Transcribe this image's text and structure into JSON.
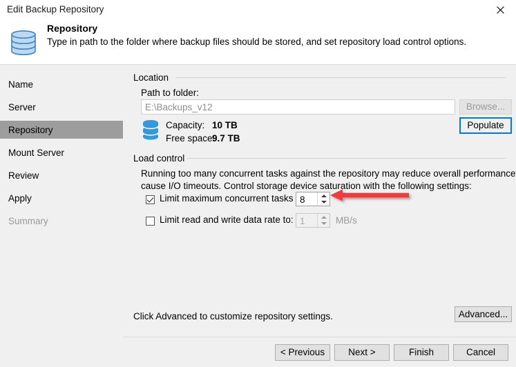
{
  "window": {
    "title": "Edit Backup Repository",
    "close_icon": "close-icon"
  },
  "header": {
    "icon": "repository-database-icon",
    "title": "Repository",
    "subtitle": "Type in path to the folder where backup files should be stored, and set repository load control options."
  },
  "sidebar": {
    "items": [
      {
        "label": "Name",
        "state": "normal"
      },
      {
        "label": "Server",
        "state": "normal"
      },
      {
        "label": "Repository",
        "state": "selected"
      },
      {
        "label": "Mount Server",
        "state": "normal"
      },
      {
        "label": "Review",
        "state": "normal"
      },
      {
        "label": "Apply",
        "state": "normal"
      },
      {
        "label": "Summary",
        "state": "disabled"
      }
    ]
  },
  "location": {
    "group_label": "Location",
    "path_label": "Path to folder:",
    "path_value": "E:\\Backups_v12",
    "browse_label": "Browse...",
    "populate_label": "Populate",
    "storage_icon": "database-icon",
    "capacity_label": "Capacity:",
    "capacity_value": "10 TB",
    "free_space_label": "Free space:",
    "free_space_value": "9.7 TB"
  },
  "load_control": {
    "group_label": "Load control",
    "description_line1": "Running too many concurrent tasks against the repository may reduce overall performance, and",
    "description_line2": "cause I/O timeouts. Control storage device saturation with the following settings:",
    "limit_tasks": {
      "label": "Limit maximum concurrent tasks to:",
      "checked": true,
      "value": "8"
    },
    "limit_rate": {
      "label": "Limit read and write data rate to:",
      "checked": false,
      "value": "1",
      "unit": "MB/s"
    }
  },
  "advanced": {
    "hint": "Click Advanced to customize repository settings.",
    "button_label": "Advanced..."
  },
  "footer": {
    "previous_label": "< Previous",
    "next_label": "Next >",
    "finish_label": "Finish",
    "cancel_label": "Cancel"
  },
  "annotation": {
    "arrow_color": "#f4393c",
    "arrow_name": "red-arrow-pointer"
  }
}
